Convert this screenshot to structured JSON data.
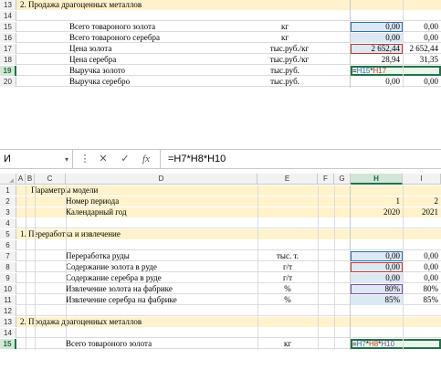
{
  "top_pane": {
    "rows": [
      {
        "n": "13",
        "b": "2. Продажа драгоценных металлов",
        "section": true
      },
      {
        "n": "14"
      },
      {
        "n": "15",
        "d": "Всего товароного золота",
        "e": "кг",
        "h": "0,00",
        "i": "0,00"
      },
      {
        "n": "16",
        "d": "Всего товароного серебра",
        "e": "кг",
        "h": "0,00",
        "i": "0,00"
      },
      {
        "n": "17",
        "d": "Цена золота",
        "e": "тыс.руб./кг",
        "h": "2 652,44",
        "i": "2 652,44"
      },
      {
        "n": "18",
        "d": "Цена серебра",
        "e": "тыс.руб./кг",
        "h": "28,94",
        "i": "31,35"
      },
      {
        "n": "19",
        "d": "Выручка золото",
        "e": "тыс.руб.",
        "i": ""
      },
      {
        "n": "20",
        "d": "Выручка серебро",
        "e": "тыс.руб.",
        "h": "0,00",
        "i": "0,00"
      }
    ],
    "editing_formula": {
      "eq": "=",
      "ref1": "H15",
      "op": "*",
      "ref2": "H17"
    }
  },
  "formula_bar": {
    "name_box": "И",
    "dropdown_icon": "▾",
    "more_icon": "⋮",
    "cancel_icon": "✕",
    "enter_icon": "✓",
    "fx_icon": "fx",
    "formula": "=H7*H8*H10"
  },
  "columns": [
    "A",
    "B",
    "C",
    "D",
    "E",
    "F",
    "G",
    "H",
    "I"
  ],
  "bottom_pane": {
    "rows": [
      {
        "n": "1",
        "c": "Параметры модели",
        "yellow": true
      },
      {
        "n": "2",
        "d": "Номер периода",
        "h": "1",
        "i": "2",
        "yellow": true
      },
      {
        "n": "3",
        "d": "Календарный год",
        "h": "2020",
        "i": "2021",
        "yellow": true
      },
      {
        "n": "4"
      },
      {
        "n": "5",
        "b": "1.  Переработка и извлечение",
        "section": true
      },
      {
        "n": "6"
      },
      {
        "n": "7",
        "d": "Переработка руды",
        "e": "тыс. т.",
        "h": "0,00",
        "i": "0,00"
      },
      {
        "n": "8",
        "d": "Содержание золота в руде",
        "e": "г/т",
        "h": "0,00",
        "i": "0,00"
      },
      {
        "n": "9",
        "d": "Содержание серебра в руде",
        "e": "г/т",
        "h": "0,00",
        "i": "0,00"
      },
      {
        "n": "10",
        "d": "Извлечение золота на фабрике",
        "e": "%",
        "h": "80%",
        "i": "80%"
      },
      {
        "n": "11",
        "d": "Извлечение серебра на фабрике",
        "e": "%",
        "h": "85%",
        "i": "85%"
      },
      {
        "n": "12"
      },
      {
        "n": "13",
        "b": "2. Продажа драгоценных металлов",
        "section": true
      },
      {
        "n": "14"
      },
      {
        "n": "15",
        "d": "Всего товароного золота",
        "e": "кг"
      }
    ],
    "editing_formula": {
      "eq": "=",
      "ref1": "H7",
      "op1": "*",
      "ref2": "H8",
      "op2": "*",
      "ref3": "H10"
    }
  },
  "colors": {
    "accent": "#217346",
    "input_fill": "#dde8f5",
    "section_fill": "#fff2cc",
    "ref_blue": "#2e6db4",
    "ref_red": "#c0392b",
    "ref_purple": "#7b4fa7"
  }
}
